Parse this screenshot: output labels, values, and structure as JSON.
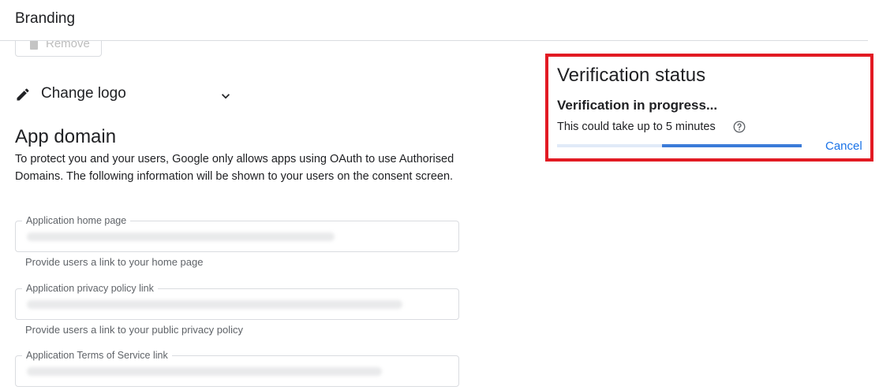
{
  "header": {
    "title": "Branding"
  },
  "logo": {
    "remove_label": "Remove",
    "change_logo_label": "Change logo"
  },
  "app_domain": {
    "title": "App domain",
    "description": "To protect you and your users, Google only allows apps using OAuth to use Authorised Domains. The following information will be shown to your users on the consent screen.",
    "fields": [
      {
        "label": "Application home page",
        "hint": "Provide users a link to your home page"
      },
      {
        "label": "Application privacy policy link",
        "hint": "Provide users a link to your public privacy policy"
      },
      {
        "label": "Application Terms of Service link"
      }
    ]
  },
  "verification": {
    "title": "Verification status",
    "status": "Verification in progress...",
    "note": "This could take up to 5 minutes",
    "cancel_label": "Cancel",
    "progress": {
      "start": 0.43,
      "end": 1.0
    }
  },
  "colors": {
    "accent": "#1a73e8",
    "progress_fill": "#3b7bd8",
    "progress_track": "#e1eaf8",
    "highlight_border": "#e21a23"
  },
  "icons": [
    "trash-icon",
    "pencil-icon",
    "chevron-down-icon",
    "help-circle-icon"
  ]
}
